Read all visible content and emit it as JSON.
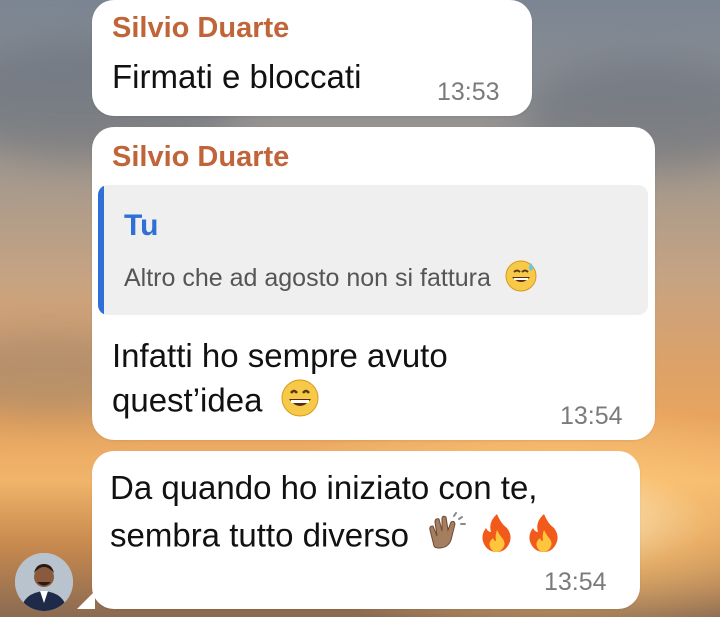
{
  "messages": [
    {
      "sender": "Silvio Duarte",
      "text": "Firmati e bloccati",
      "time": "13:53"
    },
    {
      "sender": "Silvio Duarte",
      "reply": {
        "name": "Tu",
        "text": "Altro che ad agosto non si fattura"
      },
      "line1": "Infatti ho sempre avuto",
      "line2": "quest’idea",
      "time": "13:54"
    },
    {
      "line1": "Da quando ho iniziato con te,",
      "line2": "sembra tutto diverso",
      "time": "13:54"
    }
  ],
  "emojis": {
    "sweat_smile": "sweat-smile-emoji",
    "grin": "grinning-emoji",
    "clap": "clapping-hands-emoji",
    "fire": "fire-emoji"
  },
  "colors": {
    "sender": "#c0653a",
    "reply_accent": "#2f6fd6",
    "bubble": "#ffffff",
    "time": "#7b7b7b"
  }
}
